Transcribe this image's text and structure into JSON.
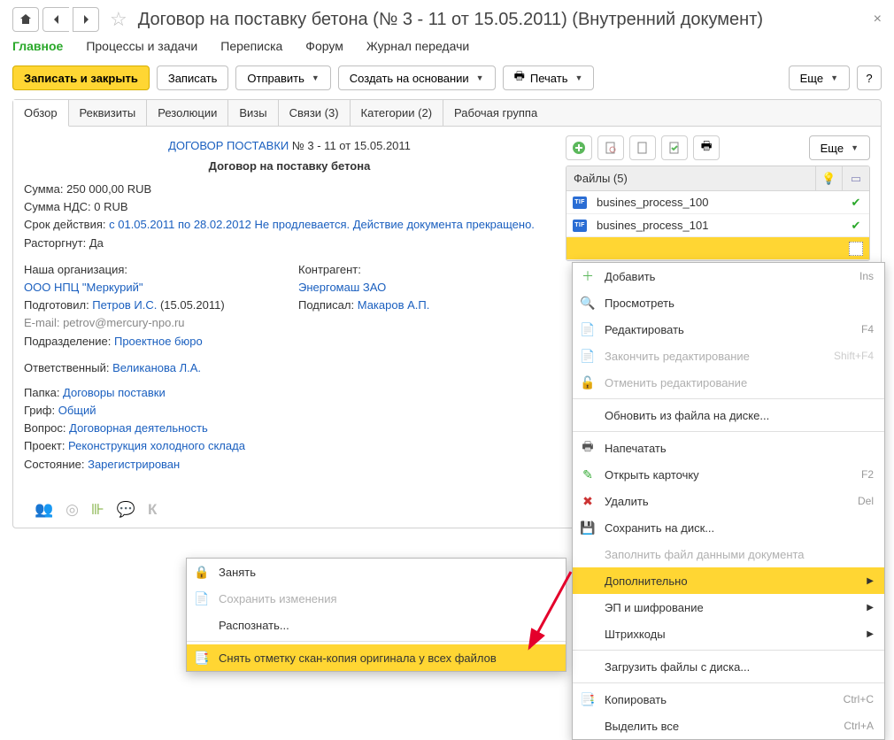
{
  "header": {
    "title": "Договор на поставку бетона (№ 3 - 11 от 15.05.2011) (Внутренний документ)"
  },
  "nav": {
    "main": "Главное",
    "processes": "Процессы и задачи",
    "correspondence": "Переписка",
    "forum": "Форум",
    "transfer_log": "Журнал передачи"
  },
  "actions": {
    "save_close": "Записать и закрыть",
    "save": "Записать",
    "send": "Отправить",
    "create_based": "Создать на основании",
    "print": "Печать",
    "more": "Еще",
    "help": "?"
  },
  "tabs": {
    "overview": "Обзор",
    "requisites": "Реквизиты",
    "resolutions": "Резолюции",
    "visas": "Визы",
    "links": "Связи (3)",
    "categories": "Категории (2)",
    "workgroup": "Рабочая группа"
  },
  "overview": {
    "head_link": "ДОГОВОР ПОСТАВКИ",
    "head_suffix": " № 3 - 11 от 15.05.2011",
    "subtitle": "Договор на поставку бетона",
    "sum_label": "Сумма: ",
    "sum_value": "250 000,00 RUB",
    "vat_label": "Сумма НДС: ",
    "vat_value": "0 RUB",
    "validity_label": "Срок действия: ",
    "validity_value": "с 01.05.2011 по 28.02.2012 Не продлевается. Действие документа прекращено.",
    "terminated_label": "Расторгнут: ",
    "terminated_value": "Да",
    "our_org_label": "Наша организация:",
    "our_org_link": "ООО НПЦ \"Меркурий\"",
    "prepared_label": "Подготовил: ",
    "prepared_link": "Петров И.С.",
    "prepared_date": " (15.05.2011)",
    "email_label": "E-mail: ",
    "email_value": "petrov@mercury-npo.ru",
    "department_label": "Подразделение: ",
    "department_link": "Проектное бюро",
    "counterparty_label": "Контрагент:",
    "counterparty_link": "Энергомаш ЗАО",
    "signed_label": "Подписал: ",
    "signed_link": "Макаров А.П.",
    "responsible_label": "Ответственный: ",
    "responsible_link": "Великанова Л.А.",
    "folder_label": "Папка: ",
    "folder_link": "Договоры поставки",
    "stamp_label": "Гриф: ",
    "stamp_link": "Общий",
    "question_label": "Вопрос: ",
    "question_link": "Договорная деятельность",
    "project_label": "Проект: ",
    "project_link": "Реконструкция холодного склада",
    "state_label": "Состояние: ",
    "state_link": "Зарегистрирован"
  },
  "files": {
    "header": "Файлы (5)",
    "more": "Еще",
    "rows": [
      {
        "name": "busines_process_100"
      },
      {
        "name": "busines_process_101"
      }
    ]
  },
  "ctx_right": {
    "add": "Добавить",
    "add_sc": "Ins",
    "view": "Просмотреть",
    "edit": "Редактировать",
    "edit_sc": "F4",
    "finish_edit": "Закончить редактирование",
    "finish_edit_sc": "Shift+F4",
    "cancel_edit": "Отменить редактирование",
    "update_file": "Обновить из файла на диске...",
    "print": "Напечатать",
    "open_card": "Открыть карточку",
    "open_card_sc": "F2",
    "delete": "Удалить",
    "delete_sc": "Del",
    "save_disk": "Сохранить на диск...",
    "fill_data": "Заполнить файл данными документа",
    "additional": "Дополнительно",
    "signing": "ЭП и шифрование",
    "barcodes": "Штрихкоды",
    "load_files": "Загрузить файлы с диска...",
    "copy": "Копировать",
    "copy_sc": "Ctrl+C",
    "select_all": "Выделить все",
    "select_all_sc": "Ctrl+A"
  },
  "ctx_left": {
    "lock": "Занять",
    "save_changes": "Сохранить изменения",
    "recognize": "Распознать...",
    "remove_scan_mark": "Снять отметку скан-копия оригинала у всех файлов"
  },
  "status_icons": {
    "k": "К"
  }
}
